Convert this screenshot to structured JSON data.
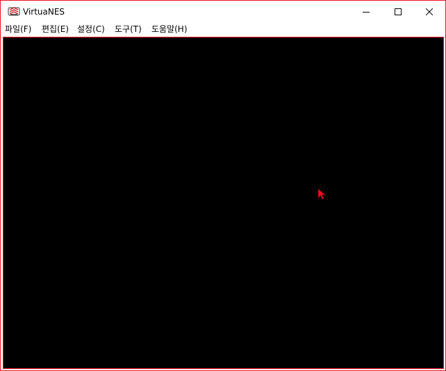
{
  "window": {
    "title": "VirtuaNES",
    "app_icon": "virtuanes-app-icon",
    "controls": {
      "minimize_icon": "minimize-icon",
      "maximize_icon": "maximize-icon",
      "close_icon": "close-icon"
    }
  },
  "menubar": {
    "items": [
      {
        "label": "파일(F)"
      },
      {
        "label": "편집(E)"
      },
      {
        "label": "설정(C)"
      },
      {
        "label": "도구(T)"
      },
      {
        "label": "도움말(H)"
      }
    ]
  },
  "colors": {
    "frame_highlight": "#e81123",
    "screen_background": "#000000",
    "cursor": "#e81123"
  },
  "screen": {
    "cursor_icon": "mouse-pointer-icon"
  }
}
